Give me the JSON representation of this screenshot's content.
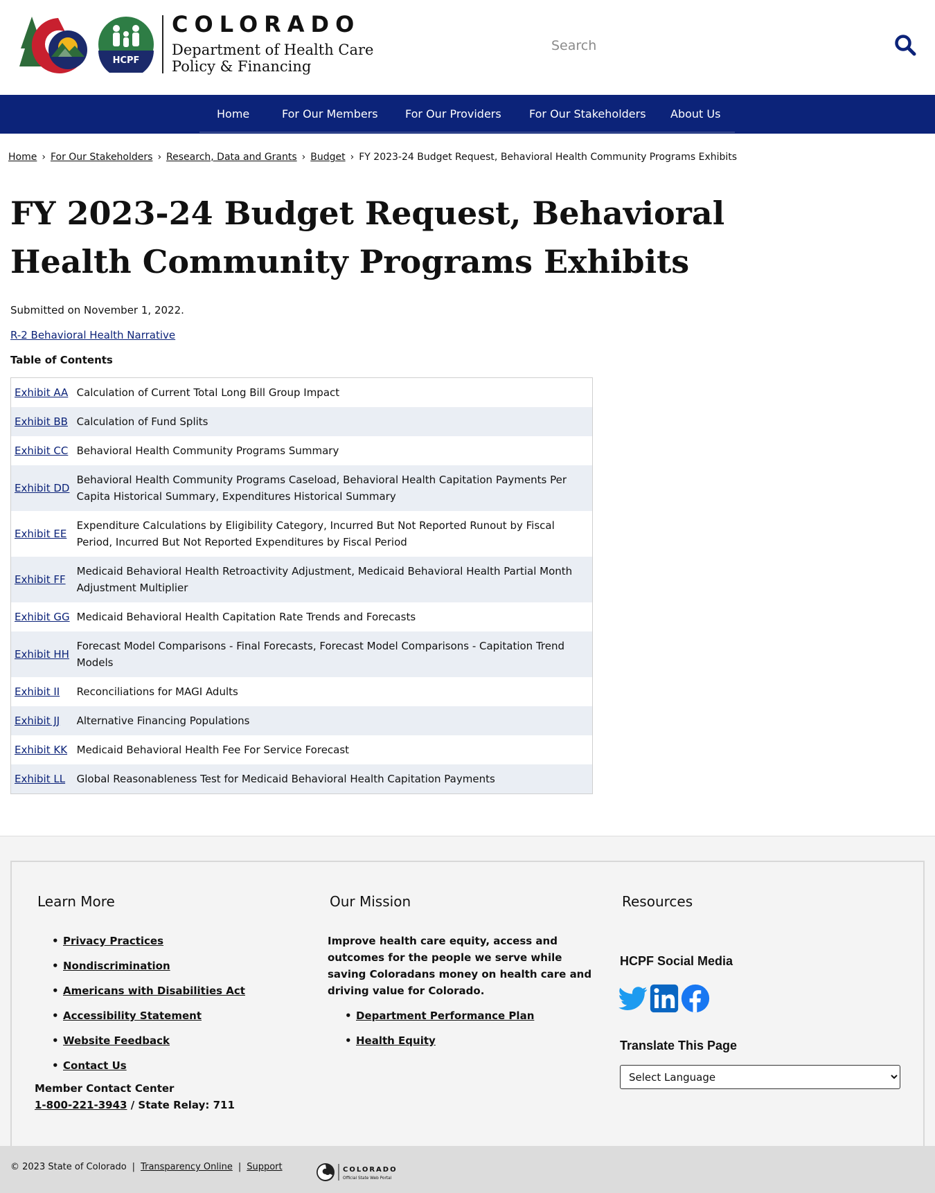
{
  "header": {
    "state_name": "COLORADO",
    "dept_line1": "Department of Health Care",
    "dept_line2": "Policy & Financing",
    "hcpf_badge": "HCPF",
    "search_placeholder": "Search",
    "search_icon": "search-icon"
  },
  "nav": {
    "items": [
      {
        "label": "Home"
      },
      {
        "label": "For Our Members"
      },
      {
        "label": "For Our Providers"
      },
      {
        "label": "For Our Stakeholders"
      },
      {
        "label": "About Us"
      }
    ]
  },
  "breadcrumb": {
    "items": [
      "Home",
      "For Our Stakeholders",
      "Research, Data and Grants",
      "Budget"
    ],
    "current": "FY 2023-24 Budget Request, Behavioral Health Community Programs Exhibits",
    "separator": "›"
  },
  "page": {
    "title": "FY 2023-24 Budget Request, Behavioral Health Community Programs Exhibits",
    "submitted": "Submitted on November 1, 2022.",
    "narrative_link": "R-2 Behavioral Health Narrative",
    "toc_heading": "Table of Contents"
  },
  "toc": [
    {
      "exhibit": "Exhibit AA",
      "description": "Calculation of Current Total Long Bill Group Impact"
    },
    {
      "exhibit": "Exhibit BB",
      "description": "Calculation of Fund Splits"
    },
    {
      "exhibit": "Exhibit CC",
      "description": "Behavioral Health Community Programs Summary"
    },
    {
      "exhibit": "Exhibit DD",
      "description": "Behavioral Health Community Programs Caseload, Behavioral Health Capitation Payments Per Capita Historical Summary, Expenditures Historical Summary"
    },
    {
      "exhibit": "Exhibit EE",
      "description": "Expenditure Calculations by Eligibility Category, Incurred But Not Reported Runout by Fiscal Period, Incurred But Not Reported Expenditures by Fiscal Period"
    },
    {
      "exhibit": "Exhibit FF",
      "description": "Medicaid Behavioral Health Retroactivity Adjustment, Medicaid Behavioral Health Partial Month Adjustment Multiplier"
    },
    {
      "exhibit": "Exhibit GG",
      "description": "Medicaid Behavioral Health Capitation Rate Trends and Forecasts"
    },
    {
      "exhibit": "Exhibit HH",
      "description": "Forecast Model Comparisons - Final Forecasts, Forecast Model Comparisons - Capitation Trend Models"
    },
    {
      "exhibit": "Exhibit II",
      "description": "Reconciliations for MAGI Adults"
    },
    {
      "exhibit": "Exhibit JJ",
      "description": "Alternative Financing Populations"
    },
    {
      "exhibit": "Exhibit KK",
      "description": "Medicaid Behavioral Health Fee For Service Forecast"
    },
    {
      "exhibit": "Exhibit LL",
      "description": "Global Reasonableness Test for Medicaid Behavioral Health Capitation Payments"
    }
  ],
  "footer": {
    "learn_more": {
      "heading": "Learn More",
      "links": [
        "Privacy Practices",
        "Nondiscrimination",
        "Americans with Disabilities Act",
        "Accessibility Statement",
        "Website Feedback",
        "Contact Us"
      ],
      "contact_label": "Member Contact Center",
      "phone": "1-800-221-3943",
      "relay": " / State Relay: 711"
    },
    "mission": {
      "heading": "Our Mission",
      "text": "Improve health care equity, access and outcomes for the people we serve while saving Coloradans money on health care and driving value for Colorado.",
      "links": [
        "Department Performance Plan",
        "Health Equity"
      ]
    },
    "resources": {
      "heading": "Resources",
      "social_heading": "HCPF Social Media",
      "social_icons": [
        "twitter-icon",
        "linkedin-icon",
        "facebook-icon"
      ],
      "translate_heading": "Translate This Page",
      "language_selected": "Select Language"
    },
    "bottom": {
      "copyright": "© 2023 State of Colorado",
      "links": [
        "Transparency Online",
        "Support"
      ],
      "portal_name": "COLORADO",
      "portal_tagline": "Official State Web Portal"
    }
  },
  "colors": {
    "nav_bg": "#0c2379",
    "link": "#0c2379",
    "row_stripe": "#eaeef4",
    "footer_bg": "#f4f4f4",
    "bottom_bar": "#dcdcdc",
    "twitter": "#1d9bf0",
    "linkedin": "#0a66c2",
    "facebook": "#1877f2"
  }
}
